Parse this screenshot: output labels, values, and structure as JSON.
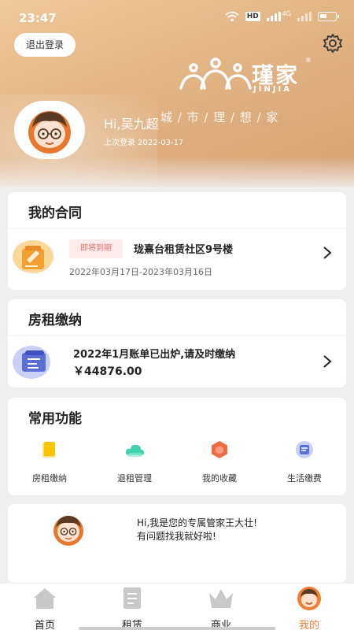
{
  "status_bar": {
    "time": "23:47",
    "network_badge": "HD",
    "net_type": "4G"
  },
  "header": {
    "logout_label": "退出登录",
    "logo_cn": "瑾家",
    "logo_en": "JINJIA",
    "logo_reg": "®",
    "slogan": "城 / 市 / 理 / 想 / 家",
    "greeting": "Hi,吴九超",
    "last_login": "上次登录 2022-03-17"
  },
  "contract": {
    "title": "我的合同",
    "badge": "即将到期",
    "name": "珑熹台租赁社区9号楼",
    "period": "2022年03月17日-2023年03月16日"
  },
  "rent": {
    "title": "房租缴纳",
    "bill_text": "2022年1月账单已出炉,请及时缴纳",
    "amount": "￥44876.00"
  },
  "functions": {
    "title": "常用功能",
    "items": [
      {
        "label": "房租缴纳",
        "icon": "rent-payment-icon",
        "color": "#f7c600"
      },
      {
        "label": "退租管理",
        "icon": "cloud-icon",
        "color": "#3fd3b0"
      },
      {
        "label": "我的收藏",
        "icon": "hexagon-icon",
        "color": "#f06a43"
      },
      {
        "label": "生活缴费",
        "icon": "bill-icon",
        "color": "#5a6fd8"
      }
    ]
  },
  "steward": {
    "message_line1": "Hi,我是您的专属管家王大壮!",
    "message_line2": "有问题找我就好啦!"
  },
  "tabbar": {
    "items": [
      {
        "label": "首页",
        "icon": "home-icon"
      },
      {
        "label": "租赁",
        "icon": "book-icon"
      },
      {
        "label": "商业",
        "icon": "crown-icon"
      },
      {
        "label": "我的",
        "icon": "profile-icon",
        "active": true
      }
    ],
    "accent": "#f07d34"
  }
}
